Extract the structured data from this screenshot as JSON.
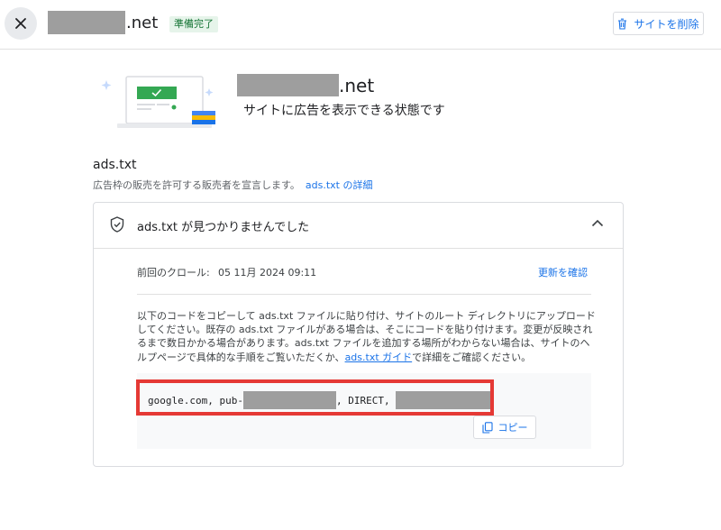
{
  "header": {
    "close_icon": "close-icon",
    "site_suffix": ".net",
    "status_badge": "準備完了",
    "delete_label": "サイトを削除",
    "delete_icon": "trash-icon"
  },
  "hero": {
    "site_suffix": ".net",
    "subtitle": "サイトに広告を表示できる状態です"
  },
  "ads_section": {
    "title": "ads.txt",
    "description": "広告枠の販売を許可する販売者を宣言します。",
    "details_link": "ads.txt の詳細",
    "card": {
      "title": "ads.txt が見つかりませんでした",
      "last_crawl_label": "前回のクロール:",
      "last_crawl_value": "05 11月 2024 09:11",
      "recheck_label": "更新を確認",
      "instructions_before_link": "以下のコードをコピーして ads.txt ファイルに貼り付け、サイトのルート ディレクトリにアップロードしてください。既存の ads.txt ファイルがある場合は、そこにコードを貼り付けます。変更が反映されるまで数日かかる場合があります。ads.txt ファイルを追加する場所がわからない場合は、サイトのヘルプページで具体的な手順をご覧いただくか、",
      "guide_link": "ads.txt ガイド",
      "instructions_after_link": "で詳細をご確認ください。",
      "code_prefix": "google.com, pub-",
      "code_middle": ", DIRECT, ",
      "copy_label": "コピー"
    }
  },
  "colors": {
    "accent": "#1a73e8",
    "badge_bg": "#e6f4ea",
    "badge_text": "#137333",
    "highlight": "#e53935",
    "redaction": "#9e9e9e"
  }
}
